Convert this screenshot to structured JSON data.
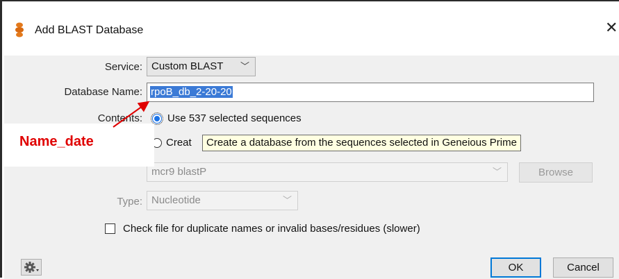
{
  "window": {
    "title": "Add BLAST Database",
    "close_glyph": "✕"
  },
  "service": {
    "label": "Service:",
    "value": "Custom BLAST"
  },
  "database_name": {
    "label": "Database Name:",
    "value": "rpoB_db_2-20-20"
  },
  "contents": {
    "label": "Contents:",
    "option_selected": "Use 537 selected sequences",
    "option_create": "Creat"
  },
  "file": {
    "value": "mcr9 blastP",
    "browse_label": "Browse"
  },
  "type": {
    "label": "Type:",
    "value": "Nucleotide"
  },
  "check_file": {
    "label": "Check file for duplicate names or invalid bases/residues (slower)",
    "checked": false
  },
  "tooltip": {
    "text": "Create a database from the sequences selected in Geneious Prime"
  },
  "annotation": {
    "text": "Name_date",
    "color": "#e00000"
  },
  "buttons": {
    "ok": "OK",
    "cancel": "Cancel"
  },
  "icons": {
    "app": "geneious-icon",
    "gear": "gear-icon",
    "dropdown": "chevron-down-icon"
  },
  "colors": {
    "accent": "#0078d7",
    "selection": "#3b7ad6",
    "tooltip_bg": "#ffffe1"
  }
}
